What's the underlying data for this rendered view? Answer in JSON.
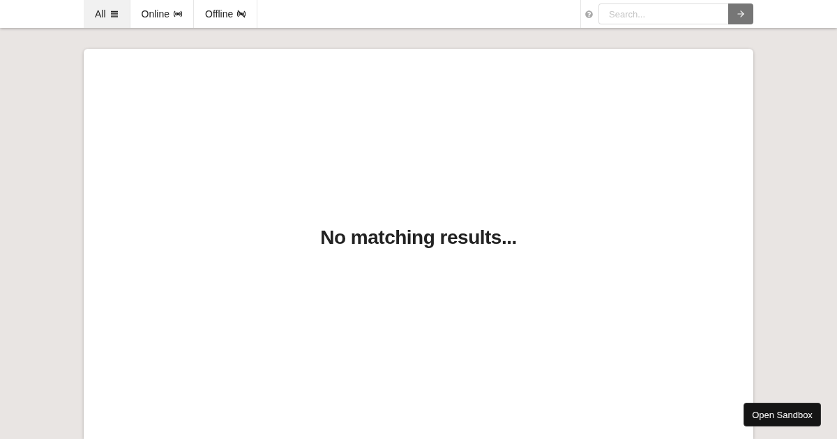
{
  "tabs": [
    {
      "label": "All",
      "kind": "all",
      "selected": true
    },
    {
      "label": "Online",
      "kind": "online",
      "selected": false
    },
    {
      "label": "Offline",
      "kind": "offline",
      "selected": false
    }
  ],
  "search": {
    "placeholder": "Search..."
  },
  "message": "No matching results...",
  "sandbox_button": "Open Sandbox"
}
